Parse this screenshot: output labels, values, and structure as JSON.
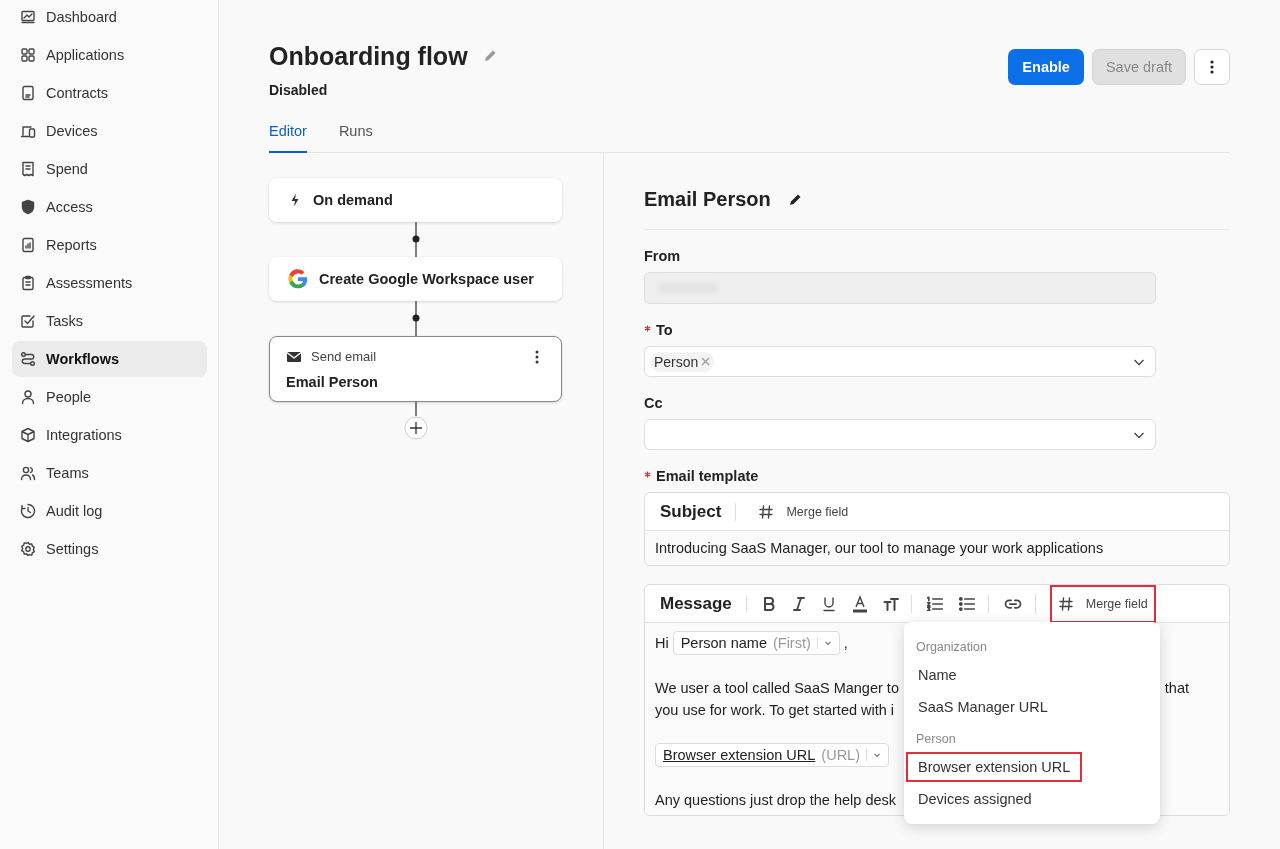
{
  "sidebar": {
    "items": [
      {
        "label": "Dashboard",
        "selected": false
      },
      {
        "label": "Applications",
        "selected": false
      },
      {
        "label": "Contracts",
        "selected": false
      },
      {
        "label": "Devices",
        "selected": false
      },
      {
        "label": "Spend",
        "selected": false
      },
      {
        "label": "Access",
        "selected": false
      },
      {
        "label": "Reports",
        "selected": false
      },
      {
        "label": "Assessments",
        "selected": false
      },
      {
        "label": "Tasks",
        "selected": false
      },
      {
        "label": "Workflows",
        "selected": true
      },
      {
        "label": "People",
        "selected": false
      },
      {
        "label": "Integrations",
        "selected": false
      },
      {
        "label": "Teams",
        "selected": false
      },
      {
        "label": "Audit log",
        "selected": false
      },
      {
        "label": "Settings",
        "selected": false
      }
    ]
  },
  "header": {
    "title": "Onboarding flow",
    "status": "Disabled",
    "buttons": [
      {
        "label": "Enable",
        "kind": "primary"
      },
      {
        "label": "Save draft",
        "kind": "disabled"
      }
    ]
  },
  "tabs": [
    {
      "label": "Editor",
      "selected": true
    },
    {
      "label": "Runs",
      "selected": false
    }
  ],
  "flow": {
    "nodes": [
      {
        "kind": "trigger",
        "label": "On demand"
      },
      {
        "kind": "google",
        "label": "Create Google Workspace user"
      },
      {
        "kind": "email",
        "type_label": "Send email",
        "label": "Email Person"
      }
    ]
  },
  "panel": {
    "title": "Email Person",
    "from": {
      "label": "From"
    },
    "to": {
      "label": "To",
      "required": true,
      "chips": [
        "Person"
      ]
    },
    "cc": {
      "label": "Cc",
      "required": false
    },
    "template": {
      "label": "Email template",
      "required": true,
      "subject": {
        "label": "Subject",
        "merge_label": "Merge field",
        "value": "Introducing SaaS Manager, our tool to manage your work applications"
      },
      "message": {
        "label": "Message",
        "merge_label": "Merge field",
        "merge_highlighted": true,
        "body": [
          {
            "kind": "greeting",
            "text": "Hi",
            "token": {
              "label": "Person name",
              "hint": "(First)"
            },
            "after": ","
          },
          {
            "kind": "text",
            "left": "We user a tool called SaaS Manger to",
            "right": "that"
          },
          {
            "kind": "text",
            "left": "you use for work. To get started with i"
          },
          {
            "kind": "token",
            "token": {
              "label": "Browser extension URL",
              "hint": "(URL)"
            }
          },
          {
            "kind": "text",
            "left": "Any questions just drop the help desk"
          }
        ]
      },
      "menu": {
        "groups": [
          {
            "label": "Organization",
            "items": [
              {
                "label": "Name",
                "highlighted": false
              },
              {
                "label": "SaaS Manager URL",
                "highlighted": false
              }
            ]
          },
          {
            "label": "Person",
            "items": [
              {
                "label": "Browser extension URL",
                "highlighted": true
              },
              {
                "label": "Devices assigned",
                "highlighted": false
              }
            ]
          }
        ]
      }
    }
  }
}
